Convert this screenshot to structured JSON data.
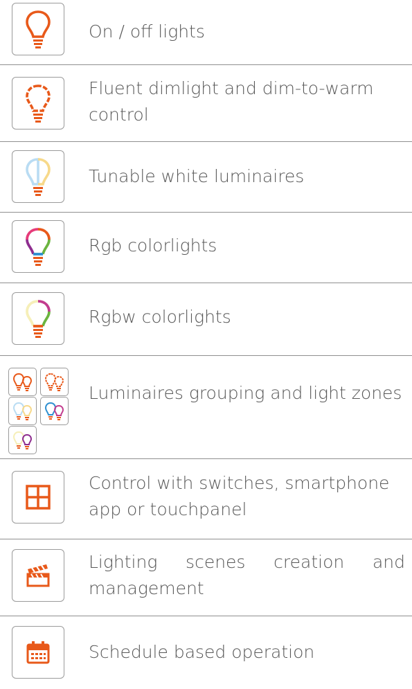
{
  "features": [
    {
      "label": "On / off lights",
      "icon": "bulb-orange-icon"
    },
    {
      "label": "Fluent dimlight and dim-to-warm control",
      "icon": "bulb-dim-icon"
    },
    {
      "label": "Tunable white luminaires",
      "icon": "bulb-tunable-white-icon"
    },
    {
      "label": "Rgb colorlights",
      "icon": "bulb-rgb-icon"
    },
    {
      "label": "Rgbw colorlights",
      "icon": "bulb-rgbw-icon"
    },
    {
      "label": "Luminaires grouping and light zones",
      "icon": "bulb-group-icon"
    },
    {
      "label": "Control with switches, smartphone app or touchpanel",
      "icon": "switch-panel-icon"
    },
    {
      "label": "Lighting scenes creation and management",
      "icon": "clapperboard-icon"
    },
    {
      "label": "Schedule based operation",
      "icon": "calendar-icon"
    }
  ],
  "colors": {
    "accent": "#e8591a",
    "border": "#9a9a9a",
    "text": "#585858"
  }
}
